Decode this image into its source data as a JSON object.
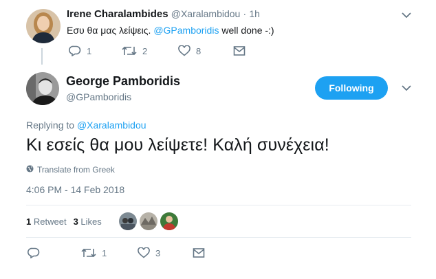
{
  "parent_tweet": {
    "author_name": "Irene Charalambides",
    "author_handle": "@Xaralambidou",
    "separator": "·",
    "time_ago": "1h",
    "text_prefix": "Εσυ θα μας λείψεις. ",
    "text_mention": "@GPamboridis",
    "text_suffix": " well done -:)",
    "actions": {
      "reply_count": "1",
      "retweet_count": "2",
      "like_count": "8"
    }
  },
  "main_tweet": {
    "author_name": "George Pamboridis",
    "author_handle": "@GPamboridis",
    "follow_button_label": "Following",
    "replying_to_label": "Replying to",
    "replying_to_handle": "@Xaralambidou",
    "text": "Κι εσείς θα μου λείψετε! Καλή συνέχεια!",
    "translate_label": "Translate from Greek",
    "timestamp": "4:06 PM - 14 Feb 2018",
    "stats": {
      "retweet_count": "1",
      "retweet_label": "Retweet",
      "like_count": "3",
      "like_label": "Likes"
    },
    "actions": {
      "reply_count": "",
      "retweet_count": "1",
      "like_count": "3"
    }
  },
  "colors": {
    "accent": "#1da1f2",
    "muted_text": "#657786",
    "primary_text": "#14171a",
    "divider": "#e6ecf0"
  },
  "icons": [
    "reply-icon",
    "retweet-icon",
    "heart-icon",
    "message-icon",
    "chevron-down-icon",
    "globe-icon"
  ]
}
